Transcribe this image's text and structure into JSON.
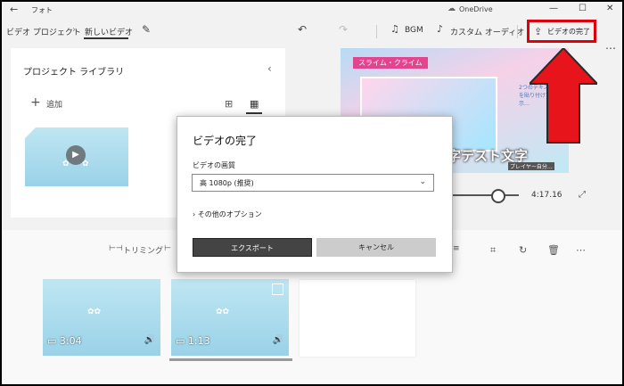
{
  "titlebar": {
    "back_icon": "back-arrow-icon",
    "app_name": "フォト",
    "onedrive_label": "OneDrive",
    "controls": [
      "minimize",
      "maximize",
      "close"
    ]
  },
  "toolbar": {
    "breadcrumb_project": "ビデオ プロジェクト",
    "breadcrumb_current": "新しいビデオ",
    "bgm_label": "BGM",
    "custom_audio_label": "カスタム オーディオ",
    "finish_label": "ビデオの完了",
    "more_label": "…"
  },
  "library": {
    "title": "プロジェクト ライブラリ",
    "add_label": "追加"
  },
  "preview": {
    "overlay_tag": "スライム・クライム",
    "caption_text": "字テスト文字",
    "caption_sub": "プレイヤー自分…",
    "side_text": "2つのテキストを貼り付けて表示…",
    "time": "4:17.16"
  },
  "storyboard": {
    "trim_label": "トリミング",
    "clips": [
      {
        "duration": "3:04"
      },
      {
        "duration": "1:13"
      }
    ]
  },
  "dialog": {
    "title": "ビデオの完了",
    "quality_label": "ビデオの画質",
    "quality_value": "高 1080p (推奨)",
    "more_options": "その他のオプション",
    "export_label": "エクスポート",
    "cancel_label": "キャンセル"
  },
  "colors": {
    "highlight": "#e0000b",
    "arrow": "#e8141c",
    "export_button": "#444444"
  }
}
